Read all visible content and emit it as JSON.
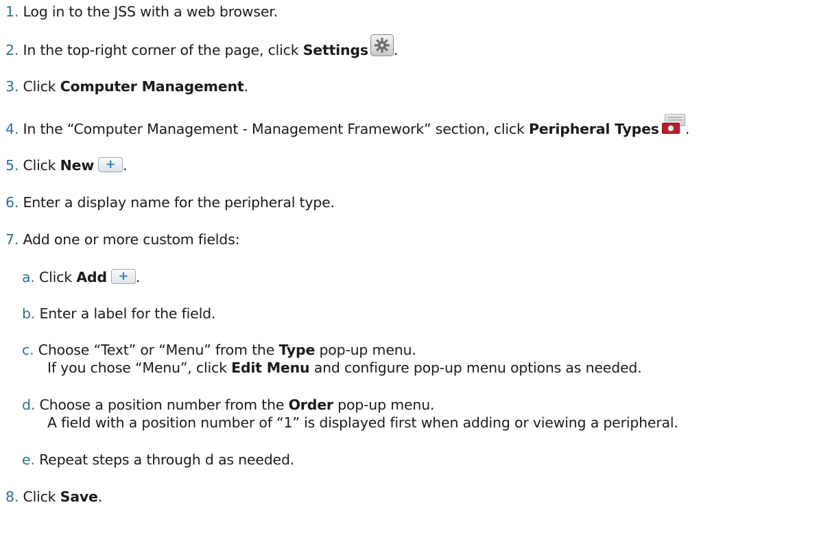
{
  "steps": [
    {
      "num": "1.",
      "text": "Log in to the JSS with a web browser."
    },
    {
      "num": "2.",
      "pre": "In the top-right corner of the page, click ",
      "bold": "Settings",
      "post": "."
    },
    {
      "num": "3.",
      "pre": "Click ",
      "bold": "Computer Management",
      "post": "."
    },
    {
      "num": "4.",
      "pre": "In the “Computer Management - Management Framework” section, click ",
      "bold": "Peripheral Types",
      "post": "."
    },
    {
      "num": "5.",
      "pre": "Click ",
      "bold": "New",
      "post": "."
    },
    {
      "num": "6.",
      "text": "Enter a display name for the peripheral type."
    },
    {
      "num": "7.",
      "text": "Add one or more custom fields:"
    },
    {
      "num": "8.",
      "pre": "Click ",
      "bold": "Save",
      "post": "."
    }
  ],
  "substeps": [
    {
      "letter": "a.",
      "pre": "Click ",
      "bold": "Add",
      "post": "."
    },
    {
      "letter": "b.",
      "text": "Enter a label for the field."
    },
    {
      "letter": "c.",
      "pre": "Choose “Text” or “Menu” from the ",
      "bold": "Type",
      "post": " pop-up menu.",
      "line2_pre": "If you chose “Menu”, click ",
      "line2_bold": "Edit Menu",
      "line2_post": " and configure pop-up menu options as needed."
    },
    {
      "letter": "d.",
      "pre": "Choose a position number from the ",
      "bold": "Order",
      "post": " pop-up menu.",
      "line2": "A field with a position number of “1” is displayed first when adding or viewing a peripheral."
    },
    {
      "letter": "e.",
      "text": "Repeat steps a through d as needed."
    }
  ],
  "icons": {
    "settings": "gear-icon",
    "peripheral_types": "peripheral-camera-icon",
    "new": "plus-button-icon",
    "add": "plus-button-icon",
    "plus_glyph": "+"
  },
  "colors": {
    "number": "#2e6f9a",
    "plus": "#2f7fc4"
  }
}
